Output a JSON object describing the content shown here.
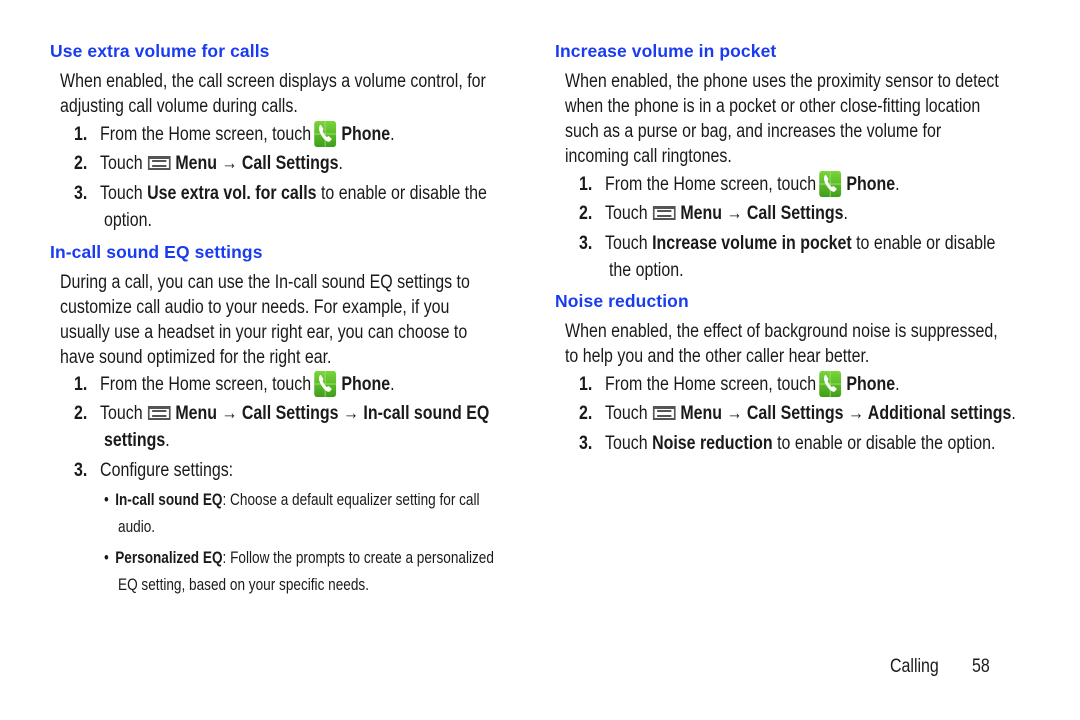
{
  "page": {
    "section": "Calling",
    "page_number": "58",
    "accent_color": "#1a3cf0"
  },
  "left": {
    "extra_volume": {
      "heading": "Use extra volume for calls",
      "body": [
        "When enabled, the call screen displays a volume control, for",
        "adjusting call volume during calls."
      ],
      "steps": [
        {
          "num": "1.",
          "pre": "From the Home screen, touch",
          "icon": "phone-icon",
          "bold": "Phone",
          "post": "."
        },
        {
          "num": "2.",
          "pre": "Touch",
          "icon": "menu-icon",
          "bold": "Menu → Call Settings",
          "post": "."
        },
        {
          "num": "3.",
          "pre": "Touch ",
          "bold": "Use extra vol. for calls",
          "post": " to enable or disable the",
          "cont": "option."
        }
      ]
    },
    "eq": {
      "heading": "In-call sound EQ settings",
      "body": [
        "During a call, you can use the In-call sound EQ settings to",
        "customize call audio to your needs. For example, if you",
        "usually use a headset in your right ear, you can choose to",
        "have sound optimized for the right ear."
      ],
      "steps": [
        {
          "num": "1.",
          "pre": "From the Home screen, touch",
          "icon": "phone-icon",
          "bold": "Phone",
          "post": "."
        },
        {
          "num": "2.",
          "pre": "Touch",
          "icon": "menu-icon",
          "bold": "Menu → Call Settings → In-call sound EQ",
          "cont_bold": "settings",
          "post": "."
        },
        {
          "num": "3.",
          "pre": "Configure settings:"
        }
      ],
      "bullets": [
        {
          "bold": "In-call sound EQ",
          "text": ": Choose a default equalizer setting for call",
          "cont": "audio."
        },
        {
          "bold": "Personalized EQ",
          "text": ": Follow the prompts to create a personalized",
          "cont": "EQ setting, based on your specific needs."
        }
      ]
    }
  },
  "right": {
    "pocket": {
      "heading": "Increase volume in pocket",
      "body": [
        "When enabled, the phone uses the proximity sensor to detect",
        "when the phone is in a pocket or other close-fitting location",
        "such as a purse or bag, and increases the volume for",
        "incoming call ringtones."
      ],
      "steps": [
        {
          "num": "1.",
          "pre": "From the Home screen, touch",
          "icon": "phone-icon",
          "bold": "Phone",
          "post": "."
        },
        {
          "num": "2.",
          "pre": "Touch",
          "icon": "menu-icon",
          "bold": "Menu → Call Settings",
          "post": "."
        },
        {
          "num": "3.",
          "pre": "Touch ",
          "bold": "Increase volume in pocket",
          "post": " to enable or disable",
          "cont": "the option."
        }
      ]
    },
    "noise": {
      "heading": "Noise reduction",
      "body": [
        "When enabled, the effect of background noise is suppressed,",
        "to help you and the other caller hear better."
      ],
      "steps": [
        {
          "num": "1.",
          "pre": "From the Home screen, touch",
          "icon": "phone-icon",
          "bold": "Phone",
          "post": "."
        },
        {
          "num": "2.",
          "pre": "Touch",
          "icon": "menu-icon",
          "bold": "Menu → Call Settings → Additional settings",
          "post": "."
        },
        {
          "num": "3.",
          "pre": "Touch ",
          "bold": "Noise reduction",
          "post": " to enable or disable the option."
        }
      ]
    }
  }
}
